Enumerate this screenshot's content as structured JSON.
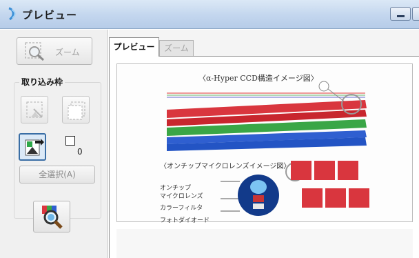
{
  "window": {
    "title": "プレビュー"
  },
  "left_panel": {
    "zoom_button_label": "ズーム",
    "crop_group_title": "取り込み枠",
    "frame_count": "0",
    "select_all_label": "全選択(A)"
  },
  "tabs": [
    {
      "label": "プレビュー",
      "active": true
    },
    {
      "label": "ズーム",
      "active": false
    }
  ],
  "preview": {
    "caption_top": "〈α-Hyper CCD構造イメージ図〉",
    "caption_mid": "〈オンチップマイクロレンズイメージ図〉",
    "labels": [
      "オンチップ",
      "マイクロレンズ",
      "カラーフィルタ",
      "フォトダイオード"
    ]
  },
  "colors": {
    "accent": "#3a6ea5",
    "red": "#d9363e",
    "green": "#3aa646",
    "blue": "#2f5fd0"
  }
}
